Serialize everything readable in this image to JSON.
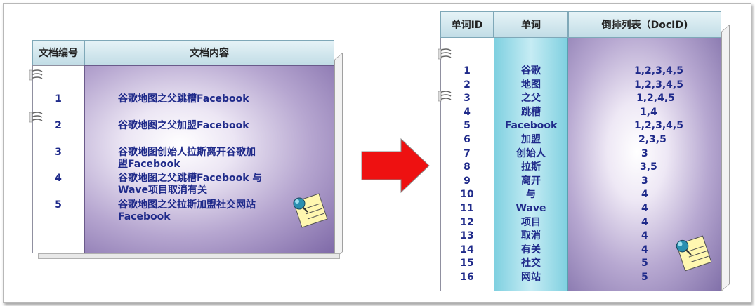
{
  "left_table": {
    "headers": {
      "doc_id": "文档编号",
      "content": "文档内容"
    },
    "rows": [
      {
        "id": "1",
        "text": [
          "谷歌地图之父跳槽Facebook"
        ]
      },
      {
        "id": "2",
        "text": [
          "谷歌地图之父加盟Facebook"
        ]
      },
      {
        "id": "3",
        "text": [
          "谷歌地图创始人拉斯离开谷歌加",
          "盟Facebook"
        ]
      },
      {
        "id": "4",
        "text": [
          "谷歌地图之父跳槽Facebook 与",
          "Wave项目取消有关"
        ]
      },
      {
        "id": "5",
        "text": [
          "谷歌地图之父拉斯加盟社交网站",
          "Facebook"
        ]
      }
    ]
  },
  "right_table": {
    "headers": {
      "word_id": "单词ID",
      "word": "单词",
      "posting": "倒排列表（DocID)"
    },
    "rows": [
      {
        "id": "1",
        "word": "谷歌",
        "list": "1,2,3,4,5"
      },
      {
        "id": "2",
        "word": "地图",
        "list": "1,2,3,4,5"
      },
      {
        "id": "3",
        "word": "之父",
        "list": "1,2,4,5"
      },
      {
        "id": "4",
        "word": "跳槽",
        "list": "1,4"
      },
      {
        "id": "5",
        "word": "Facebook",
        "list": "1,2,3,4,5"
      },
      {
        "id": "6",
        "word": "加盟",
        "list": "2,3,5"
      },
      {
        "id": "7",
        "word": "创始人",
        "list": "3"
      },
      {
        "id": "8",
        "word": "拉斯",
        "list": "3,5"
      },
      {
        "id": "9",
        "word": "离开",
        "list": "3"
      },
      {
        "id": "10",
        "word": "与",
        "list": "4"
      },
      {
        "id": "11",
        "word": "Wave",
        "list": "4"
      },
      {
        "id": "12",
        "word": "项目",
        "list": "4"
      },
      {
        "id": "13",
        "word": "取消",
        "list": "4"
      },
      {
        "id": "14",
        "word": "有关",
        "list": "4"
      },
      {
        "id": "15",
        "word": "社交",
        "list": "5"
      },
      {
        "id": "16",
        "word": "网站",
        "list": "5"
      }
    ]
  },
  "icons": [
    "binder-ring-icon",
    "pushpin-note-icon",
    "right-arrow-icon"
  ],
  "colors": {
    "arrow": "#ee1111",
    "text": "#1f2a8a",
    "header": "#c2dde6",
    "word_col": "#7fd0e0",
    "purple": "#7f6aa8"
  }
}
